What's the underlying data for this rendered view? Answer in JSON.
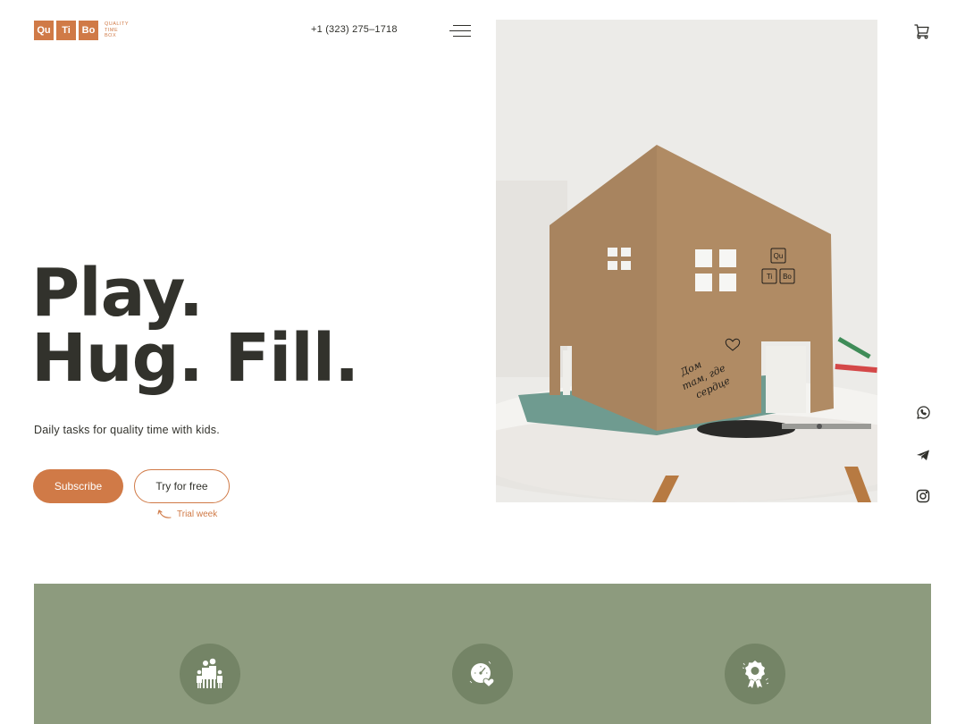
{
  "brand": {
    "tiles": [
      "Qu",
      "Ti",
      "Bo"
    ],
    "tagline": [
      "QUALITY",
      "TIME",
      "BOX"
    ],
    "accent_color": "#d07a47"
  },
  "header": {
    "phone": "+1 (323) 275–1718",
    "menu_icon": "hamburger-menu-icon",
    "cart_icon": "shopping-cart-icon"
  },
  "hero": {
    "headline_lines": [
      "Play.",
      "Hug. Fill."
    ],
    "subtitle": "Daily tasks for quality time with kids.",
    "subscribe_label": "Subscribe",
    "try_label": "Try for free",
    "trial_note": "Trial week",
    "image_alt": "Cardboard house craft with QuTiBo logo and handwritten note on a white table",
    "image_text": [
      "Дом",
      "там, где",
      "сердце"
    ]
  },
  "social": [
    {
      "name": "whatsapp",
      "icon": "whatsapp-icon"
    },
    {
      "name": "telegram",
      "icon": "telegram-icon"
    },
    {
      "name": "instagram",
      "icon": "instagram-icon"
    }
  ],
  "features": {
    "background_color": "#8d9b7e",
    "items": [
      {
        "icon": "family-icon"
      },
      {
        "icon": "clock-heart-icon"
      },
      {
        "icon": "award-badge-icon"
      }
    ]
  }
}
